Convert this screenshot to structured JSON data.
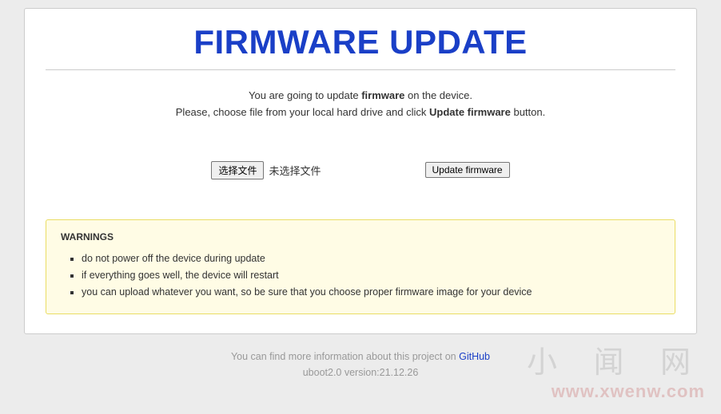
{
  "title": "FIRMWARE UPDATE",
  "intro": {
    "line1_pre": "You are going to update ",
    "line1_bold": "firmware",
    "line1_post": " on the device.",
    "line2_pre": "Please, choose file from your local hard drive and click ",
    "line2_bold": "Update firmware",
    "line2_post": " button."
  },
  "controls": {
    "choose_file_label": "选择文件",
    "no_file_text": "未选择文件",
    "update_button_label": "Update firmware"
  },
  "warnings": {
    "heading": "WARNINGS",
    "items": [
      "do not power off the device during update",
      "if everything goes well, the device will restart",
      "you can upload whatever you want, so be sure that you choose proper firmware image for your device"
    ]
  },
  "footer": {
    "info_pre": "You can find more information about this project on ",
    "link_text": "GitHub",
    "version": "uboot2.0 version:21.12.26"
  },
  "watermark": {
    "cn": "小 闻 网",
    "url": "www.xwenw.com"
  }
}
